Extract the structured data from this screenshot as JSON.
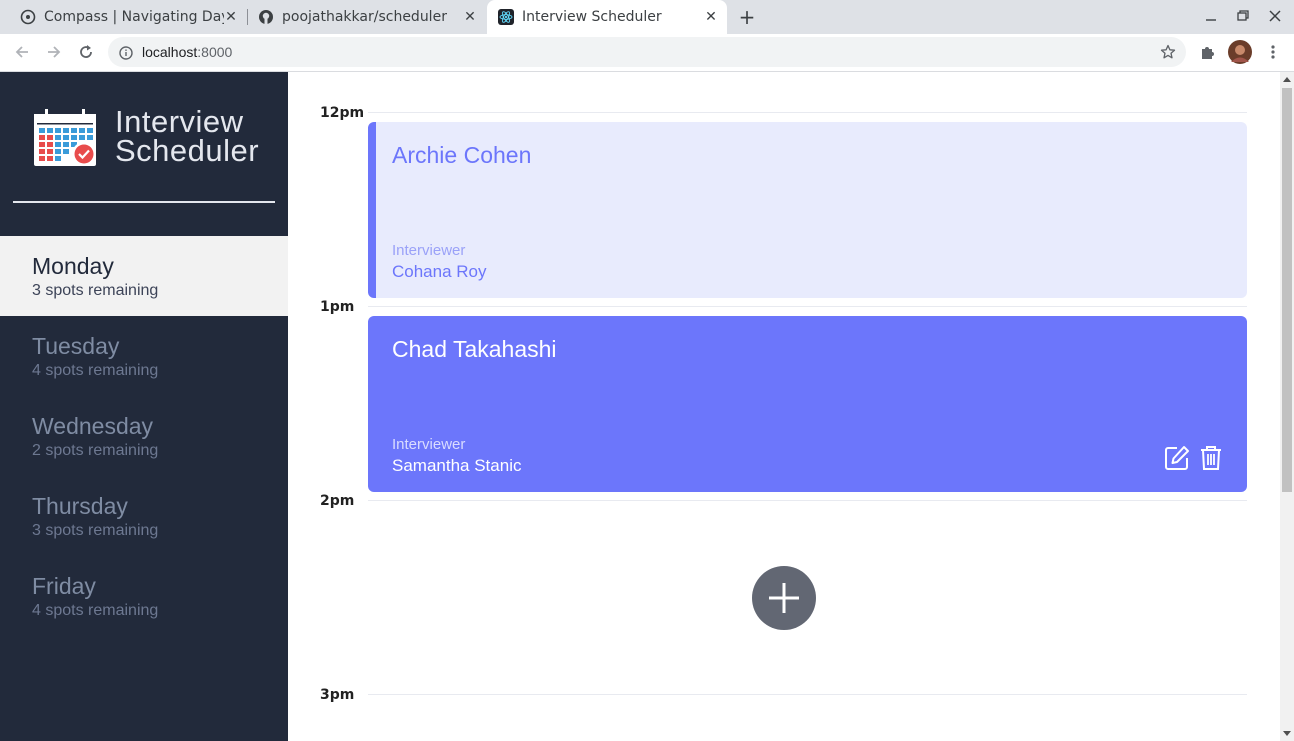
{
  "browser": {
    "tabs": [
      {
        "title": "Compass | Navigating Day",
        "icon": "compass-icon"
      },
      {
        "title": "poojathakkar/scheduler",
        "icon": "github-icon"
      },
      {
        "title": "Interview Scheduler",
        "icon": "react-icon",
        "active": true
      }
    ],
    "url_host": "localhost",
    "url_port": ":8000",
    "newtab_label": "+",
    "close_glyph": "✕"
  },
  "app": {
    "title_line1": "Interview",
    "title_line2": "Scheduler",
    "days": [
      {
        "name": "Monday",
        "spots": "3 spots remaining",
        "selected": true
      },
      {
        "name": "Tuesday",
        "spots": "4 spots remaining"
      },
      {
        "name": "Wednesday",
        "spots": "2 spots remaining"
      },
      {
        "name": "Thursday",
        "spots": "3 spots remaining"
      },
      {
        "name": "Friday",
        "spots": "4 spots remaining"
      }
    ],
    "slots": [
      {
        "time": "12pm"
      },
      {
        "time": "1pm"
      },
      {
        "time": "2pm"
      },
      {
        "time": "3pm"
      }
    ],
    "appointments": [
      {
        "student": "Archie Cohen",
        "interviewer_label": "Interviewer",
        "interviewer": "Cohana Roy"
      },
      {
        "student": "Chad Takahashi",
        "interviewer_label": "Interviewer",
        "interviewer": "Samantha Stanic"
      }
    ]
  },
  "colors": {
    "sidebar_bg": "#222a3b",
    "accent": "#6c76fb",
    "accent_light": "#e8ebfd",
    "add_button": "#626773"
  }
}
